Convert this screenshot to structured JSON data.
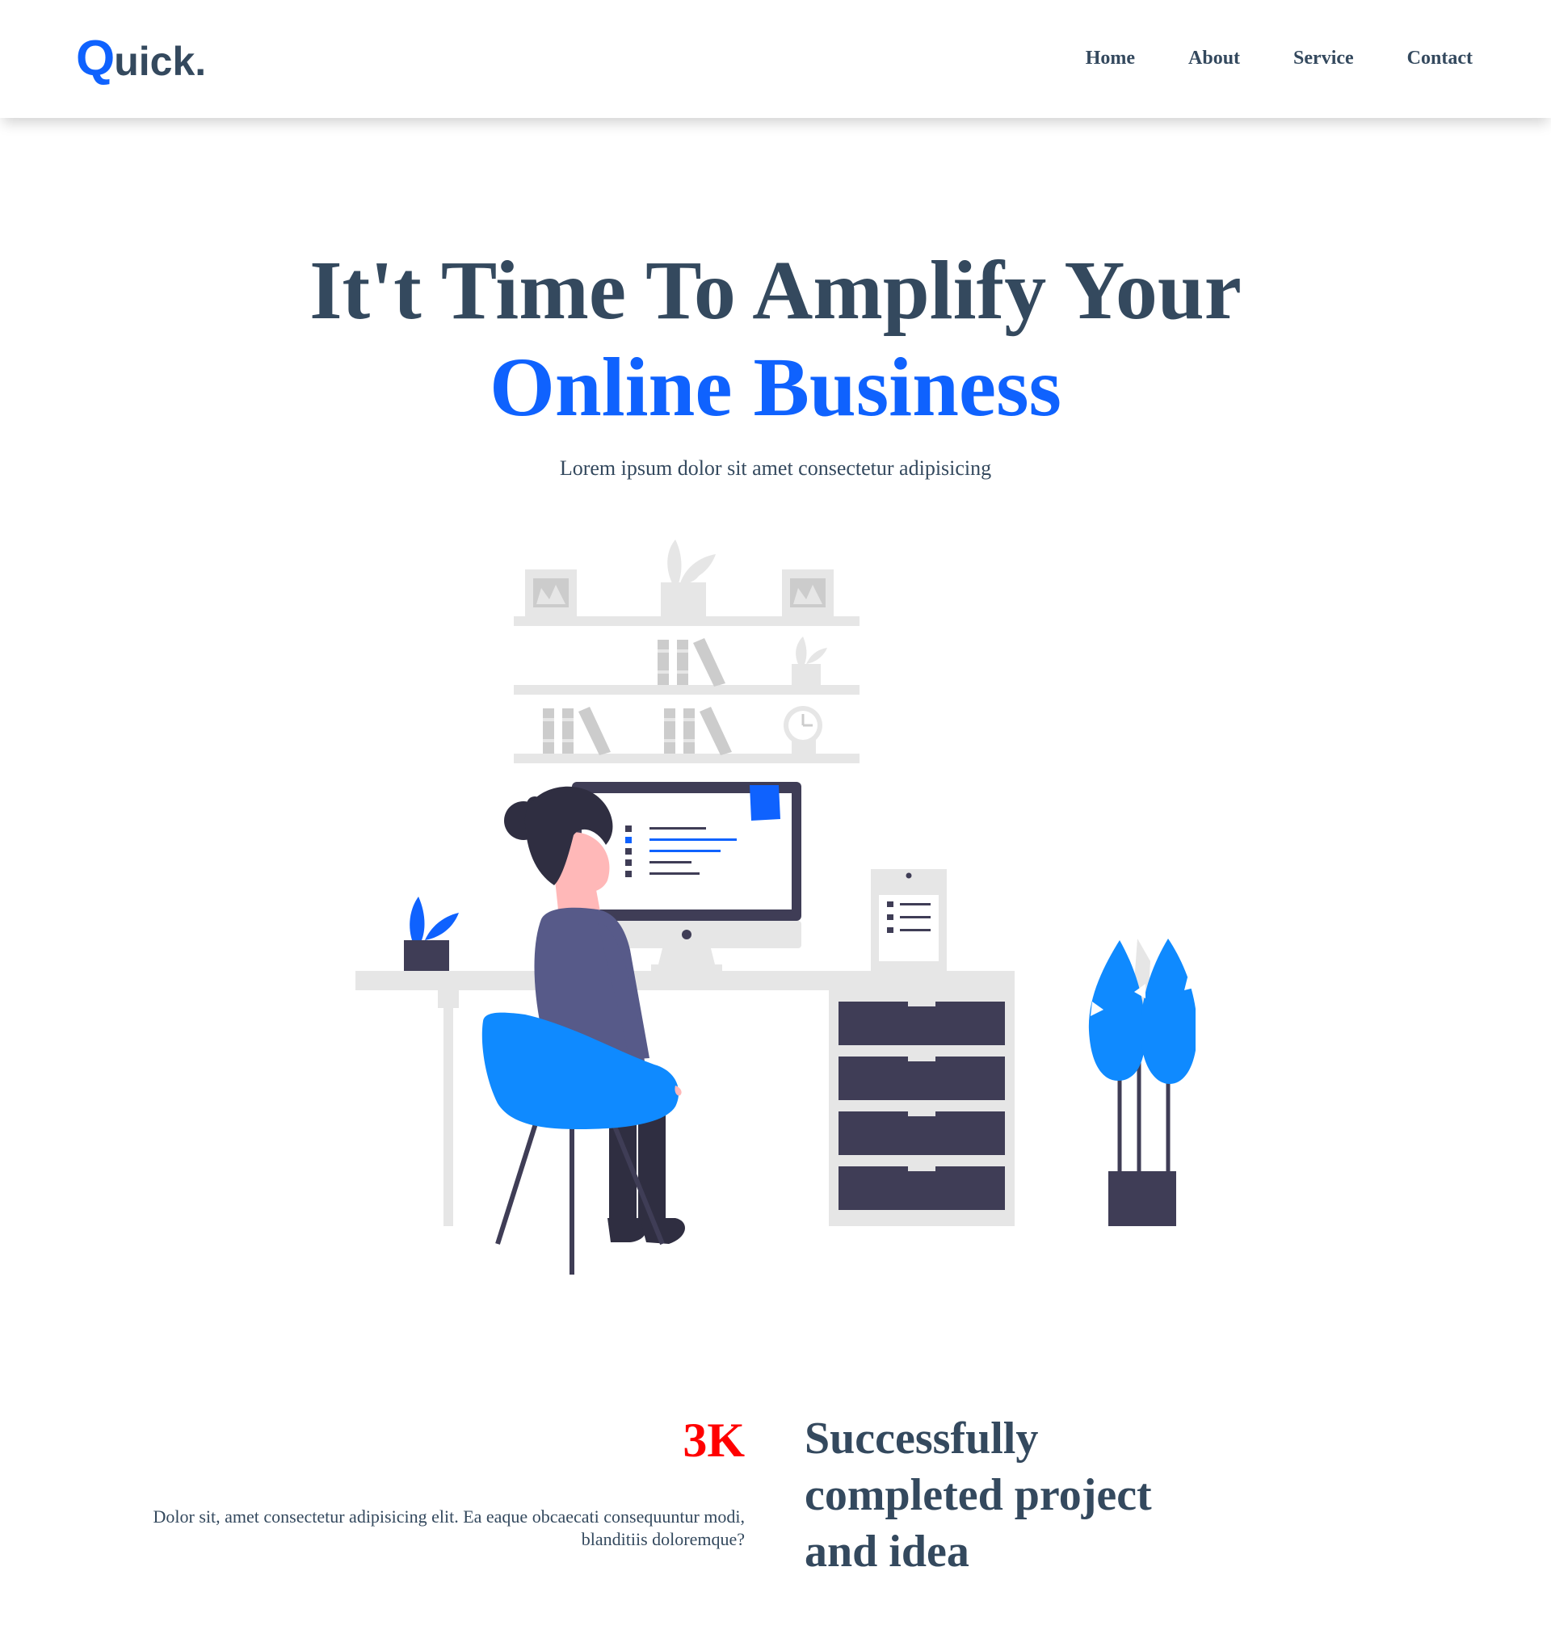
{
  "brand": {
    "logo_initial": "Q",
    "logo_rest": "uick.",
    "primary_color": "#0f62fe",
    "text_color": "#34495e",
    "stat_color": "#ff0000"
  },
  "nav": {
    "items": [
      {
        "label": "Home"
      },
      {
        "label": "About"
      },
      {
        "label": "Service"
      },
      {
        "label": "Contact"
      }
    ]
  },
  "hero": {
    "title_line1": "It't Time To Amplify Your",
    "title_line2": "Online Business",
    "subtitle": "Lorem ipsum dolor sit amet consectetur adipisicing",
    "illustration_icon": "woman-at-desk-illustration"
  },
  "stats": {
    "number": "3K",
    "description": "Dolor sit, amet consectetur adipisicing elit. Ea eaque obcaecati consequuntur modi, blanditiis doloremque?",
    "heading": "Successfully completed project and idea"
  }
}
